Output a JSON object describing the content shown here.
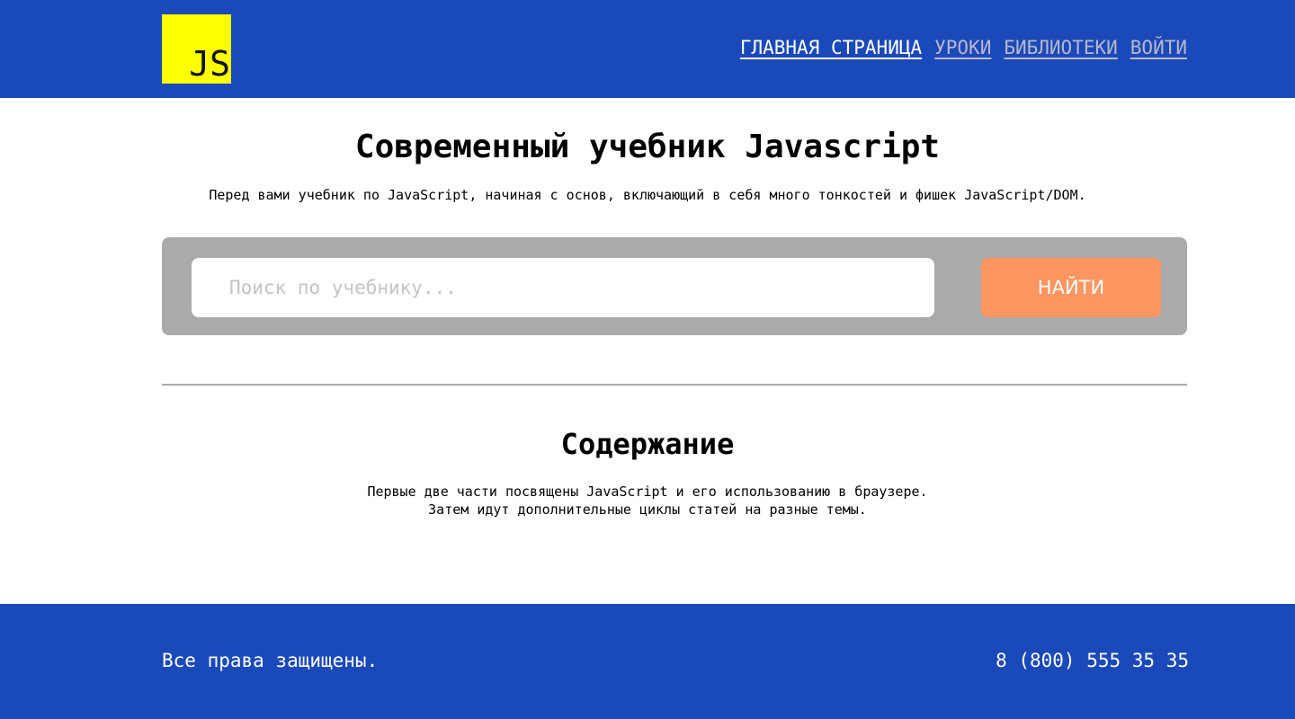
{
  "header": {
    "logo_text": "JS",
    "nav": [
      {
        "label": "ГЛАВНАЯ СТРАНИЦА",
        "active": true
      },
      {
        "label": "УРОКИ",
        "active": false
      },
      {
        "label": "БИБЛИОТЕКИ",
        "active": false
      },
      {
        "label": "ВОЙТИ",
        "active": false
      }
    ]
  },
  "main": {
    "title": "Современный учебник Javascript",
    "subtitle": "Перед вами учебник по JavaScript, начиная с основ, включающий в себя много тонкостей и фишек JavaScript/DOM.",
    "search": {
      "placeholder": "Поиск по учебнику...",
      "value": "",
      "button_label": "НАЙТИ"
    },
    "contents": {
      "title": "Содержание",
      "lines": [
        "Первые две части посвящены JavaScript и его использованию в браузере.",
        "Затем идут дополнительные циклы статей на разные темы."
      ]
    }
  },
  "footer": {
    "copyright": "Все права защищены.",
    "phone": "8 (800) 555 35 35"
  },
  "colors": {
    "header_bg": "#1a49b9",
    "logo_bg": "#ffff00",
    "search_panel_bg": "#aaaaaa",
    "search_button_bg": "#ff9560",
    "nav_active": "#ffffff",
    "nav_inactive": "#b8b8c9"
  }
}
